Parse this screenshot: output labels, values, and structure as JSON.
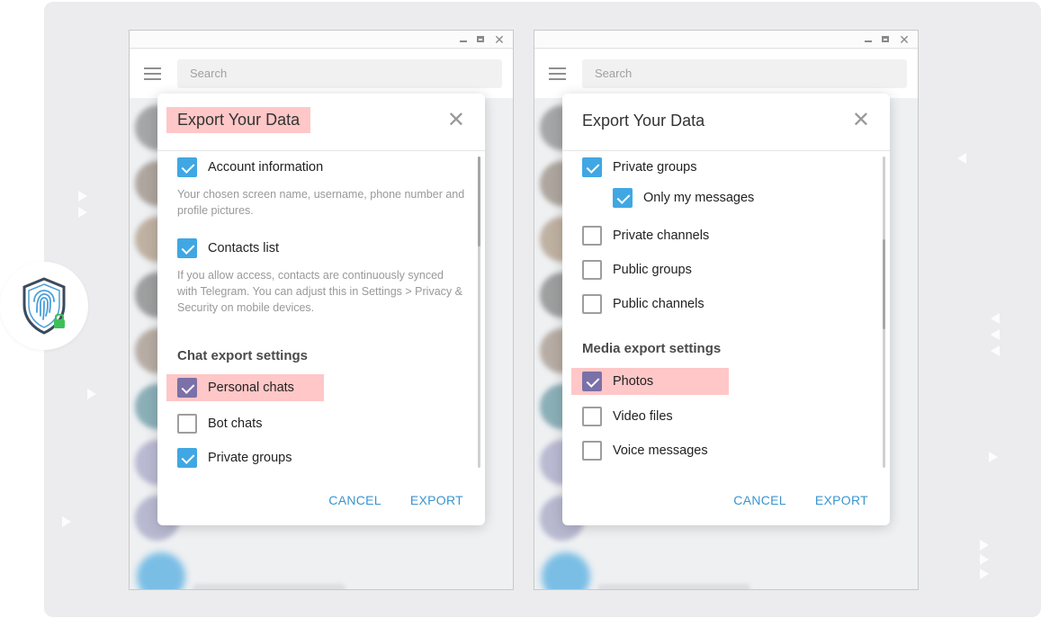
{
  "colors": {
    "accent": "#40a7e3",
    "highlight": "#ffc7c7",
    "checked_alt": "#7b70a8",
    "action": "#3a95cf"
  },
  "icons": {
    "window_minimize": "minimize-icon",
    "window_maximize": "maximize-icon",
    "window_close": "close-icon",
    "menu": "hamburger-menu-icon",
    "dialog_close": "close-icon",
    "badge": "fingerprint-shield-icon"
  },
  "left_window": {
    "search_placeholder": "Search",
    "dialog": {
      "title": "Export Your Data",
      "close_glyph": "✕",
      "items": [
        {
          "label": "Account information",
          "checked": true
        },
        {
          "label": "Contacts list",
          "checked": true
        },
        {
          "label": "Personal chats",
          "checked": true
        },
        {
          "label": "Bot chats",
          "checked": false
        },
        {
          "label": "Private groups",
          "checked": true
        }
      ],
      "account_desc": "Your chosen screen name, username, phone number and profile pictures.",
      "contacts_desc": "If you allow access, contacts are continuously synced with Telegram. You can adjust this in Settings > Privacy & Security on mobile devices.",
      "section_chat": "Chat export settings",
      "cancel": "CANCEL",
      "export": "EXPORT"
    }
  },
  "right_window": {
    "search_placeholder": "Search",
    "dialog": {
      "title": "Export Your Data",
      "close_glyph": "✕",
      "items": [
        {
          "label": "Private groups",
          "checked": true
        },
        {
          "label": "Only my messages",
          "checked": true
        },
        {
          "label": "Private channels",
          "checked": false
        },
        {
          "label": "Public groups",
          "checked": false
        },
        {
          "label": "Public channels",
          "checked": false
        },
        {
          "label": "Photos",
          "checked": true
        },
        {
          "label": "Video files",
          "checked": false
        },
        {
          "label": "Voice messages",
          "checked": false
        }
      ],
      "section_media": "Media export settings",
      "cancel": "CANCEL",
      "export": "EXPORT"
    }
  }
}
